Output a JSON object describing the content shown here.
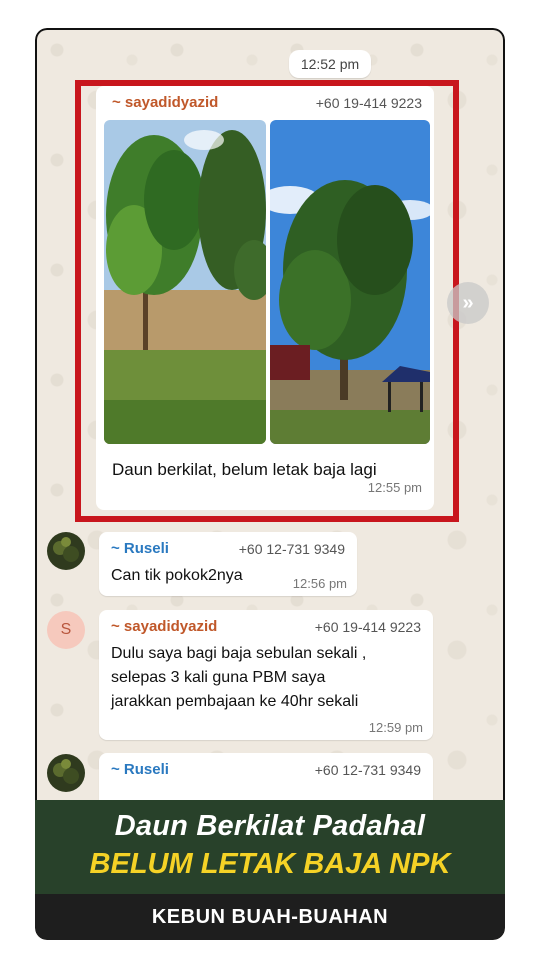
{
  "chat": {
    "date_pill": "12:52 pm",
    "messages": [
      {
        "sender": "~ sayadidyazid",
        "phone": "+60 19-414 9223",
        "caption": "Daun berkilat, belum letak baja lagi",
        "time": "12:55 pm",
        "sender_color": "#c0582a"
      },
      {
        "sender": "~ Ruseli",
        "phone": "+60 12-731 9349",
        "text": "Can tik pokok2nya",
        "time": "12:56 pm",
        "sender_color": "#2a79c0"
      },
      {
        "sender": "~ sayadidyazid",
        "phone": "+60 19-414 9223",
        "avatar_letter": "S",
        "text_lines": [
          "Dulu saya bagi baja sebulan sekali ,",
          "selepas 3 kali guna PBM saya",
          "jarakkan pembajaan ke 40hr sekali"
        ],
        "time": "12:59 pm",
        "sender_color": "#c0582a"
      },
      {
        "sender": "~ Ruseli",
        "phone": "+60 12-731 9349",
        "sender_color": "#2a79c0"
      }
    ]
  },
  "banner": {
    "line1": "Daun Berkilat Padahal",
    "line2": "BELUM LETAK BAJA NPK"
  },
  "footer": {
    "label": "KEBUN BUAH-BUAHAN"
  },
  "icons": {
    "forward": "forward-icon"
  }
}
